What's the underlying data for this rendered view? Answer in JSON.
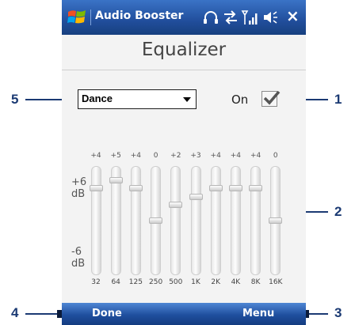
{
  "titlebar": {
    "app_title": "Audio Booster",
    "close_label": "×",
    "icons": [
      "windows-logo-icon",
      "headphones-icon",
      "connectivity-icon",
      "signal-icon",
      "volume-icon"
    ]
  },
  "heading": "Equalizer",
  "preset": {
    "selected": "Dance"
  },
  "enable": {
    "label": "On",
    "checked": true
  },
  "equalizer": {
    "db_max_label": "+6\ndB",
    "db_min_label": "-6\ndB",
    "range_db": [
      -6,
      6
    ],
    "bands": [
      {
        "freq": "32",
        "gain": "+4"
      },
      {
        "freq": "64",
        "gain": "+5"
      },
      {
        "freq": "125",
        "gain": "+4"
      },
      {
        "freq": "250",
        "gain": "0"
      },
      {
        "freq": "500",
        "gain": "+2"
      },
      {
        "freq": "1K",
        "gain": "+3"
      },
      {
        "freq": "2K",
        "gain": "+4"
      },
      {
        "freq": "4K",
        "gain": "+4"
      },
      {
        "freq": "8K",
        "gain": "+4"
      },
      {
        "freq": "16K",
        "gain": "0"
      }
    ]
  },
  "softkeys": {
    "left": "Done",
    "right": "Menu"
  },
  "callouts": [
    "1",
    "2",
    "3",
    "4",
    "5"
  ],
  "colors": {
    "titlebar": "#214e9c",
    "callout": "#1b3a73"
  }
}
